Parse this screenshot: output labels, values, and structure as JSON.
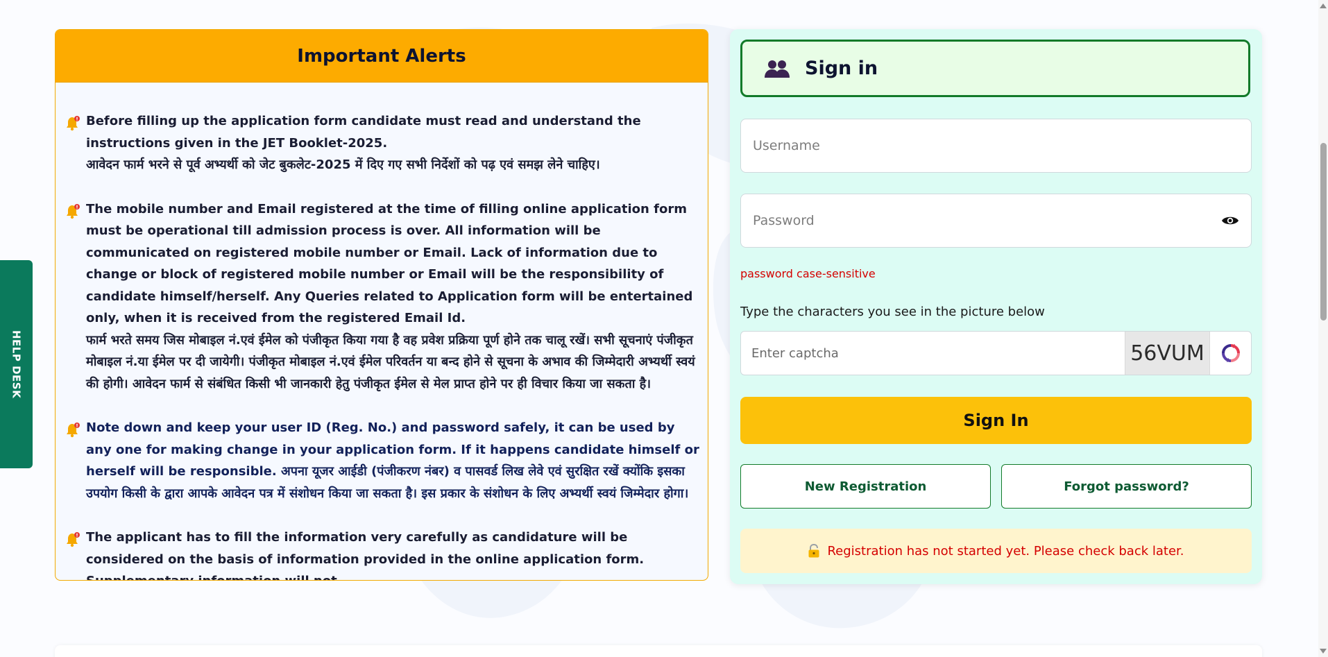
{
  "help_desk": {
    "label": "HELP DESK"
  },
  "alerts": {
    "title": "Important Alerts",
    "items": [
      {
        "text": "Before filling up the application form candidate must read and understand the instructions given in the JET Booklet-2025.\nआवेदन फार्म भरने से पूर्व अभ्यर्थी को जेट बुकलेट-2025 में दिए गए सभी निर्देशों को पढ़ एवं समझ लेने चाहिए।"
      },
      {
        "text": "The mobile number and Email registered at the time of filling online application form must be operational till admission process is over. All information will be communicated on registered mobile number or Email. Lack of information due to change or block of registered mobile number or Email will be the responsibility of candidate himself/herself. Any Queries related to Application form will be entertained only, when it is received from the registered Email Id.\nफार्म भरते समय जिस मोबाइल नं.एवं ईमेल को पंजीकृत किया गया है वह प्रवेश प्रक्रिया पूर्ण होने तक चालू रखें। सभी सूचनाएं पंजीकृत मोबाइल नं.या ईमेल पर दी जायेगी। पंजीकृत मोबाइल नं.एवं ईमेल परिवर्तन या बन्द होने से सूचना के अभाव की जिम्मेदारी अभ्यर्थी स्वयं की होगी। आवेदन फार्म से संबंधित किसी भी जानकारी हेतु पंजीकृत ईमेल से मेल प्राप्त होने पर ही विचार किया जा सकता है।"
      },
      {
        "text": "Note down and keep your user ID (Reg. No.) and password safely, it can be used by any one for making change in your application form. If it happens candidate himself or herself will be responsible. अपना यूजर आईडी (पंजीकरण नंबर) व पासवर्ड लिख लेवे एवं सुरक्षित रखें क्योंकि इसका उपयोग किसी के द्वारा आपके आवेदन पत्र में संशोधन किया जा सकता है। इस प्रकार के संशोधन के लिए अभ्यर्थी स्वयं जिम्मेदार होगा।"
      },
      {
        "text": "The applicant has to fill the information very carefully as candidature will be considered on the basis of information provided in the online application form. Supplementary information will not"
      }
    ]
  },
  "signin": {
    "title": "Sign in",
    "username_placeholder": "Username",
    "password_placeholder": "Password",
    "password_hint": "password case-sensitive",
    "captcha_label": "Type the characters you see in the picture below",
    "captcha_placeholder": "Enter captcha",
    "captcha_text": "56VUM",
    "submit_label": "Sign In",
    "new_registration_label": "New Registration",
    "forgot_password_label": "Forgot password?",
    "notice": "Registration has not started yet. Please check back later."
  },
  "colors": {
    "accent_orange": "#fdab00",
    "accent_yellow": "#fcc10a",
    "green": "#127a29",
    "help_desk_green": "#0b7a5c",
    "error_red": "#d40000"
  },
  "icons": [
    "bell-alert-icon",
    "users-icon",
    "eye-icon",
    "refresh-icon",
    "lock-icon"
  ]
}
